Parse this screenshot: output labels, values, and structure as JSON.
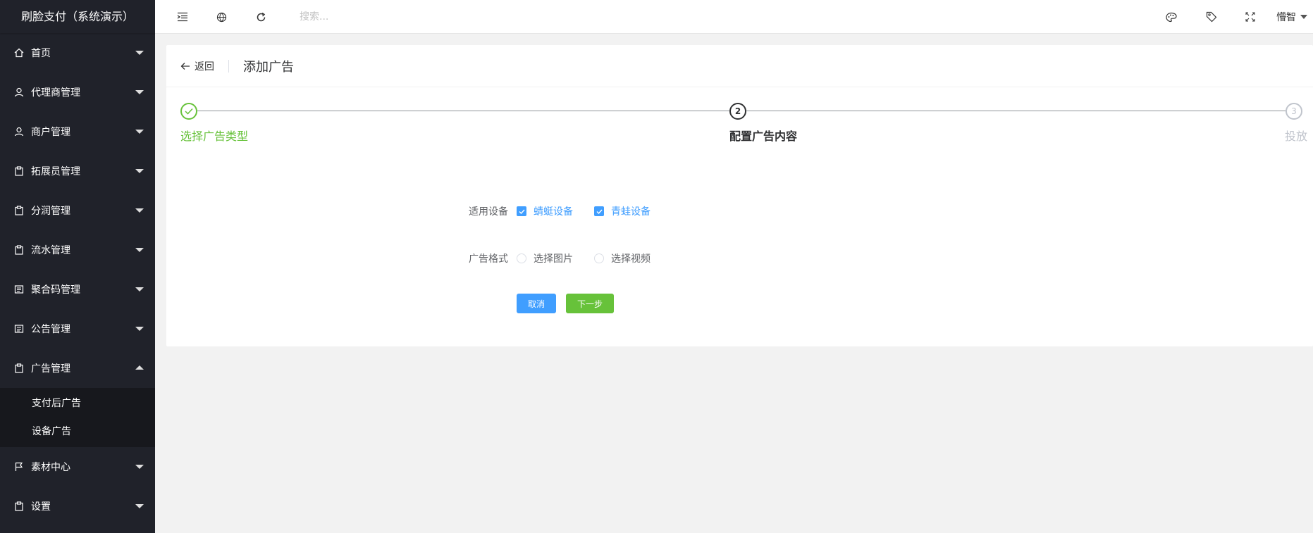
{
  "brand": {
    "title": "刷脸支付（系统演示）"
  },
  "sidebar": {
    "items": [
      {
        "label": "首页",
        "icon": "home-icon"
      },
      {
        "label": "代理商管理",
        "icon": "user-icon"
      },
      {
        "label": "商户管理",
        "icon": "user-icon"
      },
      {
        "label": "拓展员管理",
        "icon": "clipboard-icon"
      },
      {
        "label": "分润管理",
        "icon": "clipboard-icon"
      },
      {
        "label": "流水管理",
        "icon": "clipboard-icon"
      },
      {
        "label": "聚合码管理",
        "icon": "list-icon"
      },
      {
        "label": "公告管理",
        "icon": "list-icon"
      },
      {
        "label": "广告管理",
        "icon": "clipboard-icon",
        "expanded": true
      },
      {
        "label": "素材中心",
        "icon": "flag-icon"
      },
      {
        "label": "设置",
        "icon": "clipboard-icon"
      }
    ],
    "sub_items": [
      {
        "label": "支付后广告"
      },
      {
        "label": "设备广告"
      }
    ]
  },
  "header": {
    "search_placeholder": "搜索...",
    "user_name": "懵智"
  },
  "page": {
    "back_label": "返回",
    "title": "添加广告"
  },
  "steps": [
    {
      "label": "选择广告类型",
      "status": "done",
      "number": "1"
    },
    {
      "label": "配置广告内容",
      "status": "active",
      "number": "2"
    },
    {
      "label": "投放",
      "status": "wait",
      "number": "3"
    }
  ],
  "form": {
    "device_label": "适用设备",
    "devices": [
      {
        "label": "蜻蜓设备",
        "checked": true
      },
      {
        "label": "青蛙设备",
        "checked": true
      }
    ],
    "format_label": "广告格式",
    "formats": [
      {
        "label": "选择图片",
        "selected": false
      },
      {
        "label": "选择视频",
        "selected": false
      }
    ],
    "cancel_label": "取消",
    "next_label": "下一步"
  },
  "colors": {
    "sidebar_bg": "#20222a",
    "submenu_bg": "#17181d",
    "primary": "#409eff",
    "success": "#67c23a"
  }
}
